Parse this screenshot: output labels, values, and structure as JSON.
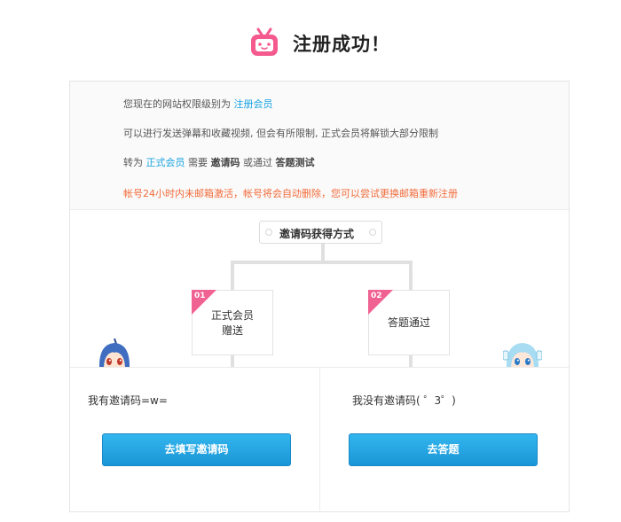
{
  "header": {
    "title": "注册成功！",
    "logo_icon": "tv-mascot-icon",
    "logo_color": "#f45a8d"
  },
  "info": {
    "line1_prefix": "您现在的网站权限级别为",
    "line1_level": "注册会员",
    "line2": "可以进行发送弹幕和收藏视频, 但会有所限制, 正式会员将解锁大部分限制",
    "line3_a": "转为",
    "line3_link": "正式会员",
    "line3_b": "需要",
    "line3_bold1": "邀请码",
    "line3_c": "或通过",
    "line3_bold2": "答题测试",
    "warning": "帐号24小时内未邮箱激活，帐号将会自动删除，您可以尝试更换邮箱重新注册"
  },
  "diagram": {
    "title": "邀请码获得方式",
    "steps": [
      {
        "num": "01",
        "line1": "正式会员",
        "line2": "赠送"
      },
      {
        "num": "02",
        "line1": "答题通过"
      }
    ]
  },
  "options": {
    "left_text": "我有邀请码=w=",
    "left_button": "去填写邀请码",
    "right_text": "我没有邀请码( ゜3゜)",
    "right_button": "去答题"
  },
  "colors": {
    "accent": "#1aa3e1",
    "warning": "#f26b3a",
    "tag": "#f06292",
    "button": "#1a96d6"
  }
}
